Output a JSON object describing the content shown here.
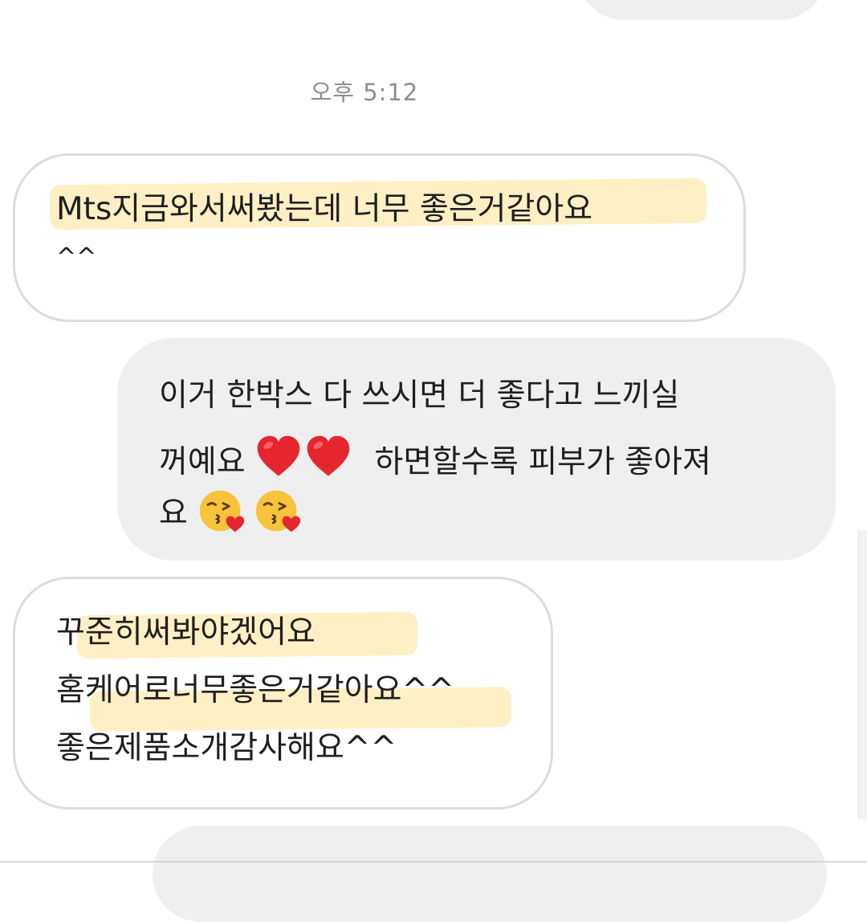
{
  "chat": {
    "timestamp": "오후 5:12",
    "messages": [
      {
        "direction": "received",
        "lines": [
          "Mts지금와서써봤는데 너무 좋은거같아요",
          "^^"
        ]
      },
      {
        "direction": "sent",
        "line1": "이거 한박스 다 쓰시면 더 좋다고 느끼실",
        "line2_pre": "꺼예요",
        "line2_post": "하면할수록 피부가 좋아져",
        "line3_pre": "요",
        "emojis": {
          "heart": "red-heart-icon",
          "kiss": "face-blowing-kiss-icon",
          "heart_color": "#e5262f",
          "kiss_color": "#f7c33b"
        }
      },
      {
        "direction": "received",
        "lines": [
          "꾸준히써봐야겠어요",
          "홈케어로너무좋은거같아요^^",
          "좋은제품소개감사해요^^"
        ]
      }
    ]
  },
  "colors": {
    "sent_bubble": "#efefef",
    "received_border": "#dcdcdc",
    "highlight": "#ffe294",
    "timestamp_text": "#8e8e8e"
  }
}
